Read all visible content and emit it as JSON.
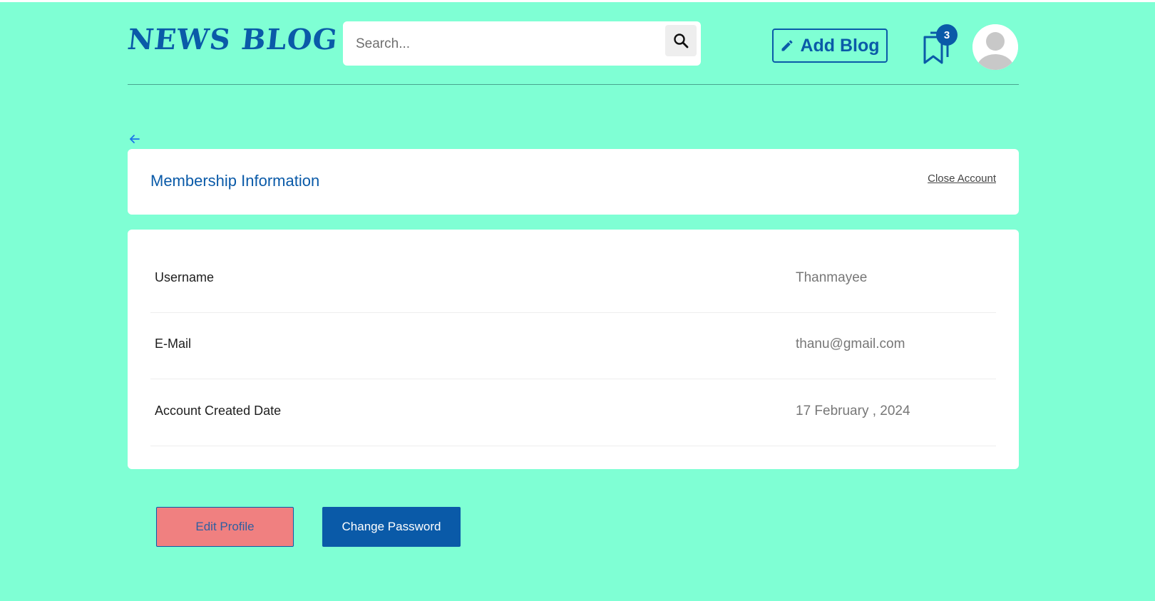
{
  "header": {
    "logo_text": "NEWS BLOG",
    "search_placeholder": "Search...",
    "add_blog_label": "Add Blog",
    "bookmark_count": "3"
  },
  "membership": {
    "title": "Membership Information",
    "close_account_label": "Close Account",
    "rows": [
      {
        "label": "Username",
        "value": "Thanmayee"
      },
      {
        "label": "E-Mail",
        "value": "thanu@gmail.com"
      },
      {
        "label": "Account Created Date",
        "value": "17 February , 2024"
      }
    ]
  },
  "actions": {
    "edit_profile_label": "Edit Profile",
    "change_password_label": "Change Password"
  },
  "colors": {
    "background": "#7fffd4",
    "primary": "#0a5aa8",
    "edit_button": "#f08080"
  }
}
